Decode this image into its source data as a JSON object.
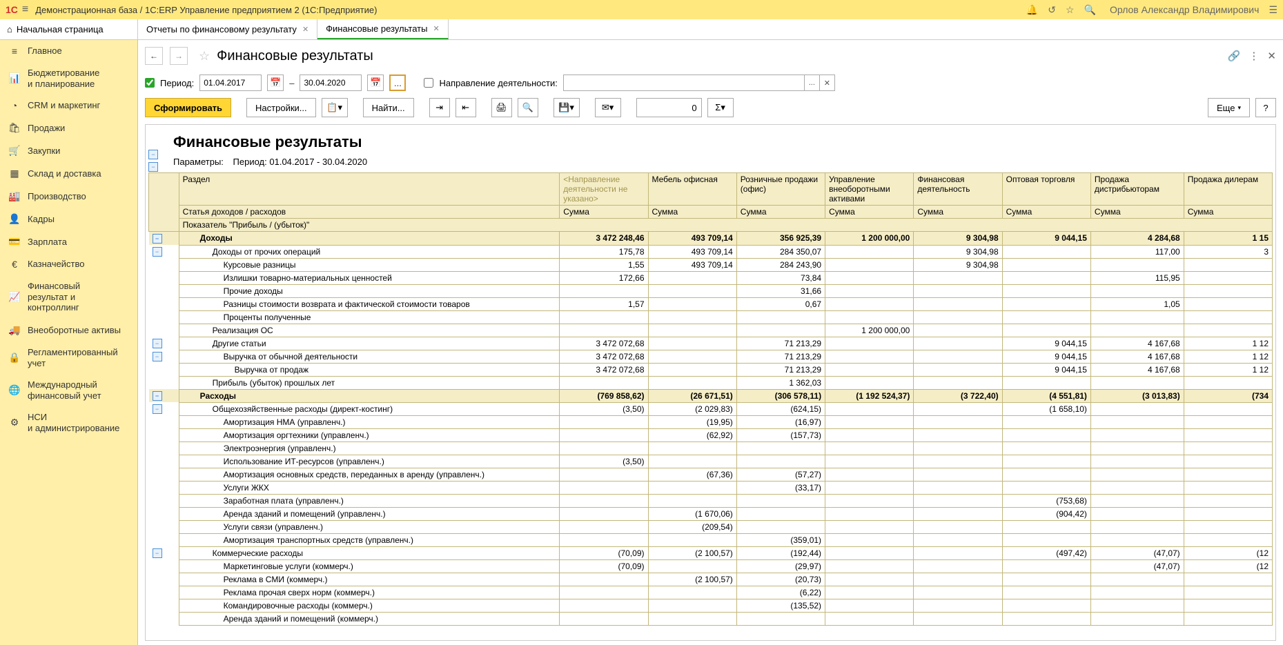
{
  "header": {
    "logo": "1C",
    "title": "Демонстрационная база / 1С:ERP Управление предприятием 2   (1С:Предприятие)",
    "user": "Орлов Александр Владимирович"
  },
  "tabs": {
    "home": "Начальная страница",
    "t1": "Отчеты по финансовому результату",
    "t2": "Финансовые результаты"
  },
  "sidebar": [
    {
      "icon": "≡",
      "label": "Главное"
    },
    {
      "icon": "📊",
      "label": "Бюджетирование\nи планирование"
    },
    {
      "icon": "◔",
      "label": "CRM и маркетинг"
    },
    {
      "icon": "🛍",
      "label": "Продажи"
    },
    {
      "icon": "🛒",
      "label": "Закупки"
    },
    {
      "icon": "▦",
      "label": "Склад и доставка"
    },
    {
      "icon": "🏭",
      "label": "Производство"
    },
    {
      "icon": "👤",
      "label": "Кадры"
    },
    {
      "icon": "💳",
      "label": "Зарплата"
    },
    {
      "icon": "€",
      "label": "Казначейство"
    },
    {
      "icon": "📈",
      "label": "Финансовый\nрезультат и контроллинг"
    },
    {
      "icon": "🚚",
      "label": "Внеоборотные активы"
    },
    {
      "icon": "🔒",
      "label": "Регламентированный\nучет"
    },
    {
      "icon": "🌐",
      "label": "Международный\nфинансовый учет"
    },
    {
      "icon": "⚙",
      "label": "НСИ\nи администрирование"
    }
  ],
  "page": {
    "title": "Финансовые результаты",
    "filter": {
      "period_label": "Период:",
      "date_from": "01.04.2017",
      "date_to": "30.04.2020",
      "direction_label": "Направление деятельности:"
    },
    "toolbar": {
      "generate": "Сформировать",
      "settings": "Настройки...",
      "find": "Найти...",
      "more": "Еще",
      "sum_value": "0"
    }
  },
  "report": {
    "title": "Финансовые результаты",
    "params_label": "Параметры:",
    "params_value": "Период: 01.04.2017 - 30.04.2020",
    "hdr": {
      "section": "Раздел",
      "dir_unspec": "<Направление деятельности не указано>",
      "cols": [
        "Мебель офисная",
        "Розничные продажи (офис)",
        "Управление внеоборотными активами",
        "Финансовая деятельность",
        "Оптовая торговля",
        "Продажа дистрибьюторам",
        "Продажа дилерам"
      ],
      "article": "Статья доходов / расходов",
      "sum": "Сумма",
      "indicator": "Показатель \"Прибыль / (убыток)\""
    },
    "rows": [
      {
        "type": "section",
        "label": "Доходы",
        "v": [
          "3 472 248,46",
          "493 709,14",
          "356 925,39",
          "1 200 000,00",
          "9 304,98",
          "9 044,15",
          "4 284,68",
          "1 15"
        ]
      },
      {
        "ind": 1,
        "tree": true,
        "label": "Доходы от прочих операций",
        "v": [
          "175,78",
          "493 709,14",
          "284 350,07",
          "",
          "9 304,98",
          "",
          "117,00",
          "3"
        ]
      },
      {
        "ind": 2,
        "label": "Курсовые разницы",
        "v": [
          "1,55",
          "493 709,14",
          "284 243,90",
          "",
          "9 304,98",
          "",
          "",
          ""
        ]
      },
      {
        "ind": 2,
        "label": "Излишки товарно-материальных ценностей",
        "v": [
          "172,66",
          "",
          "73,84",
          "",
          "",
          "",
          "115,95",
          ""
        ]
      },
      {
        "ind": 2,
        "label": "Прочие доходы",
        "v": [
          "",
          "",
          "31,66",
          "",
          "",
          "",
          "",
          ""
        ]
      },
      {
        "ind": 2,
        "label": "Разницы стоимости возврата и фактической стоимости товаров",
        "v": [
          "1,57",
          "",
          "0,67",
          "",
          "",
          "",
          "1,05",
          ""
        ]
      },
      {
        "ind": 2,
        "label": "Проценты полученные",
        "v": [
          "",
          "",
          "",
          "",
          "",
          "",
          "",
          ""
        ]
      },
      {
        "ind": 1,
        "label": "Реализация ОС",
        "v": [
          "",
          "",
          "",
          "1 200 000,00",
          "",
          "",
          "",
          ""
        ]
      },
      {
        "ind": 1,
        "tree": true,
        "label": "Другие статьи",
        "v": [
          "3 472 072,68",
          "",
          "71 213,29",
          "",
          "",
          "9 044,15",
          "4 167,68",
          "1 12"
        ]
      },
      {
        "ind": 2,
        "tree": true,
        "label": "Выручка от обычной деятельности",
        "v": [
          "3 472 072,68",
          "",
          "71 213,29",
          "",
          "",
          "9 044,15",
          "4 167,68",
          "1 12"
        ]
      },
      {
        "ind": 3,
        "label": "Выручка от продаж",
        "v": [
          "3 472 072,68",
          "",
          "71 213,29",
          "",
          "",
          "9 044,15",
          "4 167,68",
          "1 12"
        ]
      },
      {
        "ind": 1,
        "label": "Прибыль (убыток) прошлых лет",
        "v": [
          "",
          "",
          "1 362,03",
          "",
          "",
          "",
          "",
          ""
        ]
      },
      {
        "type": "section",
        "tree": true,
        "label": "Расходы",
        "v": [
          "(769 858,62)",
          "(26 671,51)",
          "(306 578,11)",
          "(1 192 524,37)",
          "(3 722,40)",
          "(4 551,81)",
          "(3 013,83)",
          "(734"
        ]
      },
      {
        "ind": 1,
        "tree": true,
        "label": "Общехозяйственные расходы (директ-костинг)",
        "v": [
          "(3,50)",
          "(2 029,83)",
          "(624,15)",
          "",
          "",
          "(1 658,10)",
          "",
          ""
        ]
      },
      {
        "ind": 2,
        "label": "Амортизация НМА (управленч.)",
        "v": [
          "",
          "(19,95)",
          "(16,97)",
          "",
          "",
          "",
          "",
          ""
        ]
      },
      {
        "ind": 2,
        "label": "Амортизация оргтехники (управленч.)",
        "v": [
          "",
          "(62,92)",
          "(157,73)",
          "",
          "",
          "",
          "",
          ""
        ]
      },
      {
        "ind": 2,
        "label": "Электроэнергия (управленч.)",
        "v": [
          "",
          "",
          "",
          "",
          "",
          "",
          "",
          ""
        ]
      },
      {
        "ind": 2,
        "label": "Использование ИТ-ресурсов (управленч.)",
        "v": [
          "(3,50)",
          "",
          "",
          "",
          "",
          "",
          "",
          ""
        ]
      },
      {
        "ind": 2,
        "label": "Амортизация основных средств, переданных в аренду (управленч.)",
        "v": [
          "",
          "(67,36)",
          "(57,27)",
          "",
          "",
          "",
          "",
          ""
        ]
      },
      {
        "ind": 2,
        "label": "Услуги ЖКХ",
        "v": [
          "",
          "",
          "(33,17)",
          "",
          "",
          "",
          "",
          ""
        ]
      },
      {
        "ind": 2,
        "label": "Заработная плата (управленч.)",
        "v": [
          "",
          "",
          "",
          "",
          "",
          "(753,68)",
          "",
          ""
        ]
      },
      {
        "ind": 2,
        "label": "Аренда зданий и помещений (управленч.)",
        "v": [
          "",
          "(1 670,06)",
          "",
          "",
          "",
          "(904,42)",
          "",
          ""
        ]
      },
      {
        "ind": 2,
        "label": "Услуги связи (управленч.)",
        "v": [
          "",
          "(209,54)",
          "",
          "",
          "",
          "",
          "",
          ""
        ]
      },
      {
        "ind": 2,
        "label": "Амортизация транспортных средств (управленч.)",
        "v": [
          "",
          "",
          "(359,01)",
          "",
          "",
          "",
          "",
          ""
        ]
      },
      {
        "ind": 1,
        "tree": true,
        "label": "Коммерческие расходы",
        "v": [
          "(70,09)",
          "(2 100,57)",
          "(192,44)",
          "",
          "",
          "(497,42)",
          "(47,07)",
          "(12"
        ]
      },
      {
        "ind": 2,
        "label": "Маркетинговые услуги (коммерч.)",
        "v": [
          "(70,09)",
          "",
          "(29,97)",
          "",
          "",
          "",
          "(47,07)",
          "(12"
        ]
      },
      {
        "ind": 2,
        "label": "Реклама в СМИ (коммерч.)",
        "v": [
          "",
          "(2 100,57)",
          "(20,73)",
          "",
          "",
          "",
          "",
          ""
        ]
      },
      {
        "ind": 2,
        "label": "Реклама прочая сверх норм (коммерч.)",
        "v": [
          "",
          "",
          "(6,22)",
          "",
          "",
          "",
          "",
          ""
        ]
      },
      {
        "ind": 2,
        "label": "Командировочные расходы (коммерч.)",
        "v": [
          "",
          "",
          "(135,52)",
          "",
          "",
          "",
          "",
          ""
        ]
      },
      {
        "ind": 2,
        "label": "Аренда зданий и помещений (коммерч.)",
        "v": [
          "",
          "",
          "",
          "",
          "",
          "",
          "",
          ""
        ]
      }
    ]
  }
}
